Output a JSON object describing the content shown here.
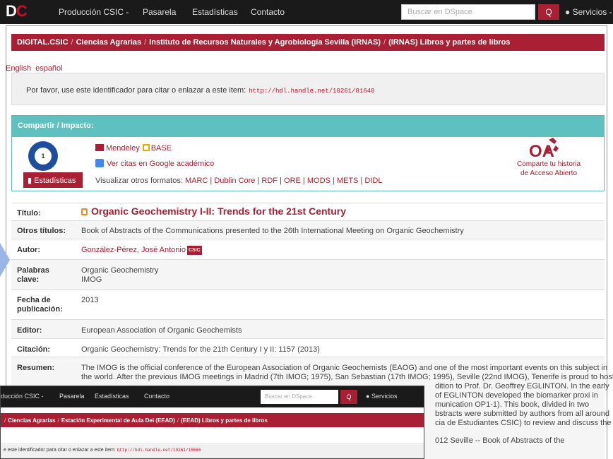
{
  "main": {
    "nav": {
      "logo": [
        "D",
        "C"
      ],
      "links": [
        "Producción CSIC -",
        "Pasarela",
        "Estadísticas",
        "Contacto"
      ],
      "search_placeholder": "Buscar en DSpace",
      "search_button": "Q",
      "servicios": "Servicios -"
    },
    "breadcrumb": [
      "DIGITAL.CSIC",
      "Ciencias Agrarias",
      "Instituto de Recursos Naturales y Agrobiología Sevilla (IRNAS)",
      "(IRNAS) Libros y partes de libros"
    ],
    "breadcrumb_sep": "/",
    "langs": [
      "English",
      "español"
    ],
    "cite": {
      "text": "Por favor, use este identificador para citar o enlazar a este item:",
      "url": "http://hdl.handle.net/10261/81640"
    },
    "share": {
      "header": "Compartir / Impacto:",
      "badge_count": "1",
      "stats_button": "Estadísticas",
      "mendeley": "Mendeley",
      "base": "BASE",
      "scholar": "Ver citas en Google académico",
      "formats_label": "Visualizar otros formatos:",
      "formats": [
        "MARC",
        "Dublin Core",
        "RDF",
        "ORE",
        "MODS",
        "METS",
        "DIDL"
      ],
      "formats_sep": " | ",
      "oa_line1": "Comparte tu historia",
      "oa_line2": "de Acceso Abierto"
    },
    "record": {
      "titulo": {
        "label": "Título:",
        "value": "Organic Geochemistry I-II: Trends for the 21st Century"
      },
      "otros": {
        "label": "Otros títulos:",
        "value": "Book of Abstracts of the Communications presented to the 26th International Meeting on Organic Geochemistry"
      },
      "autor": {
        "label": "Autor:",
        "value": "González-Pérez, José Antonio",
        "tag": "CSIC"
      },
      "palabras": {
        "label1": "Palabras",
        "label2": "clave:",
        "value1": "Organic Geochemistry",
        "value2": "IMOG"
      },
      "fecha": {
        "label1": "Fecha de",
        "label2": "publicación:",
        "value": "2013"
      },
      "editor": {
        "label": "Editor:",
        "value": "European Association of Organic Geochemists"
      },
      "citacion": {
        "label": "Citación:",
        "value": "Organic Geochemistry: Trends for the 21th Century I y II: 1157 (2013)"
      },
      "resumen": {
        "label": "Resumen:",
        "lines": [
          "The IMOG is the official conference of the European Association of Organic Geochemists (EAOG) and one of the most important events on this subject in",
          "the world. After the previous IMOG meetings in Madrid (7th IMOG; 1975), San Sebastian (17th IMOG; 1995), Seville (22nd IMOG), Tenerife is proud to host",
          "dition to Prof. Dr. Geoffrey EGLINTON. In the early",
          "of EGLINTON developed the biomarker proxi in",
          "munication OP1-1). This book, divided in two",
          "bstracts were submitted by authors from all around",
          "cia de Estudiantes CSIC) to review and discuss the",
          "012 Seville -- Book of Abstracts of the"
        ]
      }
    }
  },
  "overlay": {
    "nav": [
      "ducción CSIC -",
      "Pasarela",
      "Estadísticas",
      "Contacto"
    ],
    "search_placeholder": "Buscar en DSpace",
    "search_button": "Q",
    "servicios": "Servicios",
    "breadcrumb": [
      "",
      "Ciencias Agrarias",
      "Estación Experimental de Aula Dei (EEAD)",
      "(EEAD) Libros y partes de libros"
    ],
    "cite_text": "e este identificador para citar o enlazar a este item:",
    "cite_url": "http://hdl.handle.net/10261/15566"
  }
}
